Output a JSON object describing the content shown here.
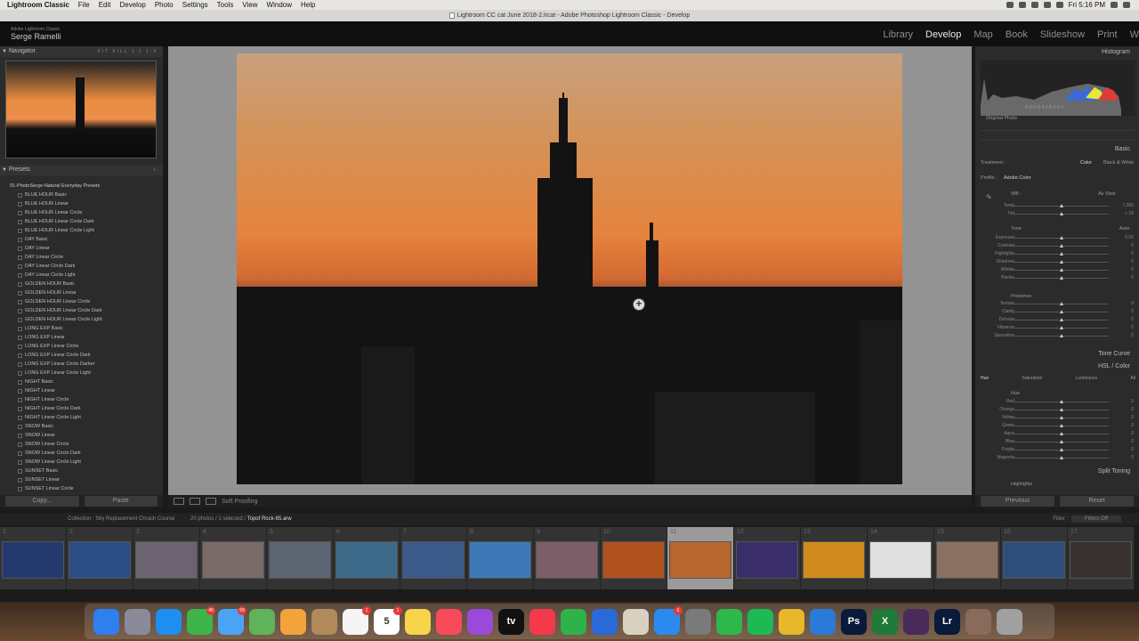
{
  "menubar": {
    "app": "Lightroom Classic",
    "items": [
      "File",
      "Edit",
      "Develop",
      "Photo",
      "Settings",
      "Tools",
      "View",
      "Window",
      "Help"
    ],
    "clock": "Fri 5:16 PM"
  },
  "titlebar": {
    "title": "Lightroom CC cat June 2018-2.lrcat - Adobe Photoshop Lightroom Classic - Develop"
  },
  "identity": {
    "product": "Adobe Lightroom Classic",
    "user": "Serge Ramelli"
  },
  "modules": [
    "Library",
    "Develop",
    "Map",
    "Book",
    "Slideshow",
    "Print",
    "W"
  ],
  "navigator": {
    "label": "Navigator",
    "options": "FIT  FILL  1:1  1:3"
  },
  "presets": {
    "label": "Presets",
    "add": "+",
    "group": "01-PhotoSerge-Natural Everyday Presets",
    "items": [
      "BLUE HOUR Basic",
      "BLUE HOUR Linear",
      "BLUE HOUR Linear Circle",
      "BLUE HOUR Linear Circle Dark",
      "BLUE HOUR Linear Circle Light",
      "DAY Basic",
      "DAY Linear",
      "DAY Linear Circle",
      "DAY Linear Circle Dark",
      "DAY Linear Circle Light",
      "GOLDEN HOUR Basic",
      "GOLDEN HOUR Linear",
      "GOLDEN HOUR Linear Circle",
      "GOLDEN HOUR Linear Circle Dark",
      "GOLDEN HOUR Linear Circle Light",
      "LONG EXP Basic",
      "LONG EXP Linear",
      "LONG EXP Linear Circle",
      "LONG EXP Linear Circle Dark",
      "LONG EXP Linear Circle Darker",
      "LONG EXP Linear Circle Light",
      "NIGHT Basic",
      "NIGHT Linear",
      "NIGHT Linear Circle",
      "NIGHT Linear Circle Dark",
      "NIGHT Linear Circle Light",
      "SNOW Basic",
      "SNOW Linear",
      "SNOW Linear Circle",
      "SNOW Linear Circle Dark",
      "SNOW Linear Circle Light",
      "SUNSET Basic",
      "SUNSET Linear",
      "SUNSET Linear Circle"
    ]
  },
  "leftbuttons": {
    "copy": "Copy...",
    "paste": "Paste"
  },
  "toolbar": {
    "softproof": "Soft Proofing"
  },
  "right": {
    "histogram": "Histogram",
    "histo_values": "R  8.6  G  8.4  B  8.9 %",
    "original_photo": "Original Photo",
    "basic": "Basic",
    "treatment_label": "Treatment :",
    "treatment_color": "Color",
    "treatment_bw": "Black & White",
    "profile_label": "Profile :",
    "profile_value": "Adobe Color",
    "wb_label": "WB :",
    "wb_value": "As Shot",
    "tone_label": "Tone",
    "auto": "Auto",
    "presence_label": "Presence",
    "tone_curve": "Tone Curve",
    "hsl": "HSL / Color",
    "hsl_tabs": [
      "Hue",
      "Saturation",
      "Luminance",
      "All"
    ],
    "hue_label": "Hue",
    "split_toning": "Split Toning",
    "highlights": "Highlights",
    "wb_sliders": [
      {
        "label": "Temp",
        "value": "7,300"
      },
      {
        "label": "Tint",
        "value": "+ 15"
      }
    ],
    "tone_sliders": [
      {
        "label": "Exposure",
        "value": "0.00"
      },
      {
        "label": "Contrast",
        "value": "0"
      },
      {
        "label": "Highlights",
        "value": "0"
      },
      {
        "label": "Shadows",
        "value": "0"
      },
      {
        "label": "Whites",
        "value": "0"
      },
      {
        "label": "Blacks",
        "value": "0"
      }
    ],
    "presence_sliders": [
      {
        "label": "Texture",
        "value": "0"
      },
      {
        "label": "Clarity",
        "value": "0"
      },
      {
        "label": "Dehaze",
        "value": "0"
      },
      {
        "label": "Vibrance",
        "value": "0"
      },
      {
        "label": "Saturation",
        "value": "0"
      }
    ],
    "hue_sliders": [
      {
        "label": "Red",
        "value": "0"
      },
      {
        "label": "Orange",
        "value": "0"
      },
      {
        "label": "Yellow",
        "value": "0"
      },
      {
        "label": "Green",
        "value": "0"
      },
      {
        "label": "Aqua",
        "value": "0"
      },
      {
        "label": "Blue",
        "value": "0"
      },
      {
        "label": "Purple",
        "value": "0"
      },
      {
        "label": "Magenta",
        "value": "0"
      }
    ],
    "previous": "Previous",
    "reset": "Reset"
  },
  "filmstrip": {
    "collection": "Collection : Sky Replacement Chrash Course",
    "count": "20 photos / 1 selected /",
    "filename": "Topof Rock-65.arw",
    "filter_label": "Filter :",
    "filter_value": "Filters Off",
    "cells": [
      {
        "num": "1",
        "color": "#243a6e"
      },
      {
        "num": "2",
        "color": "#2c4d84"
      },
      {
        "num": "3",
        "color": "#6b6470"
      },
      {
        "num": "4",
        "color": "#7a6a68"
      },
      {
        "num": "5",
        "color": "#5b6470"
      },
      {
        "num": "6",
        "color": "#3e6a8a"
      },
      {
        "num": "7",
        "color": "#3a5a8a"
      },
      {
        "num": "8",
        "color": "#3e78b8"
      },
      {
        "num": "9",
        "color": "#7a5e68"
      },
      {
        "num": "10",
        "color": "#b0521e"
      },
      {
        "num": "11",
        "color": "#b8662e"
      },
      {
        "num": "12",
        "color": "#3a2e6a"
      },
      {
        "num": "13",
        "color": "#d08a1e"
      },
      {
        "num": "14",
        "color": "#e0e0e0"
      },
      {
        "num": "15",
        "color": "#8a7060"
      },
      {
        "num": "16",
        "color": "#2e4e7a"
      },
      {
        "num": "17",
        "color": "#3a3230"
      }
    ]
  },
  "dock": {
    "icons": [
      {
        "name": "finder",
        "color": "#2f7ff0",
        "label": ""
      },
      {
        "name": "launchpad",
        "color": "#8a8a9a",
        "label": ""
      },
      {
        "name": "safari",
        "color": "#1f8ef1",
        "label": ""
      },
      {
        "name": "facetime",
        "color": "#3bb54a",
        "label": "",
        "badge": "40"
      },
      {
        "name": "messages",
        "color": "#4aa3f5",
        "label": "",
        "badge": "59"
      },
      {
        "name": "maps",
        "color": "#5fb35a",
        "label": ""
      },
      {
        "name": "photos",
        "color": "#f2a33a",
        "label": ""
      },
      {
        "name": "contacts",
        "color": "#b08a5a",
        "label": ""
      },
      {
        "name": "reminders",
        "color": "#f5f5f5",
        "label": "",
        "badge": "1"
      },
      {
        "name": "calendar",
        "color": "#ffffff",
        "label": "5",
        "badge": "1"
      },
      {
        "name": "notes",
        "color": "#f7d44a",
        "label": ""
      },
      {
        "name": "music",
        "color": "#f94a5c",
        "label": ""
      },
      {
        "name": "podcasts",
        "color": "#9a4ad8",
        "label": ""
      },
      {
        "name": "appletv",
        "color": "#111111",
        "label": "tv"
      },
      {
        "name": "news",
        "color": "#f43a4a",
        "label": ""
      },
      {
        "name": "numbers",
        "color": "#2fb24a",
        "label": ""
      },
      {
        "name": "keynote",
        "color": "#2a6ad8",
        "label": ""
      },
      {
        "name": "preview",
        "color": "#d8d0c0",
        "label": ""
      },
      {
        "name": "appstore",
        "color": "#2a8af0",
        "label": "",
        "badge": "6"
      },
      {
        "name": "systemprefs",
        "color": "#7a7a7a",
        "label": ""
      },
      {
        "name": "evernote",
        "color": "#2fb84a",
        "label": ""
      },
      {
        "name": "spotify",
        "color": "#1db954",
        "label": ""
      },
      {
        "name": "chrome",
        "color": "#e8b82a",
        "label": ""
      },
      {
        "name": "edge",
        "color": "#2a7ad8",
        "label": ""
      },
      {
        "name": "photoshop",
        "color": "#0a1a3a",
        "label": "Ps"
      },
      {
        "name": "excel",
        "color": "#1f7a3a",
        "label": "X"
      },
      {
        "name": "slack",
        "color": "#4a2a5a",
        "label": ""
      },
      {
        "name": "lightroom",
        "color": "#0a1a3a",
        "label": "Lr"
      },
      {
        "name": "folder",
        "color": "#8a6a5a",
        "label": ""
      },
      {
        "name": "trash",
        "color": "#a0a0a0",
        "label": ""
      }
    ]
  }
}
